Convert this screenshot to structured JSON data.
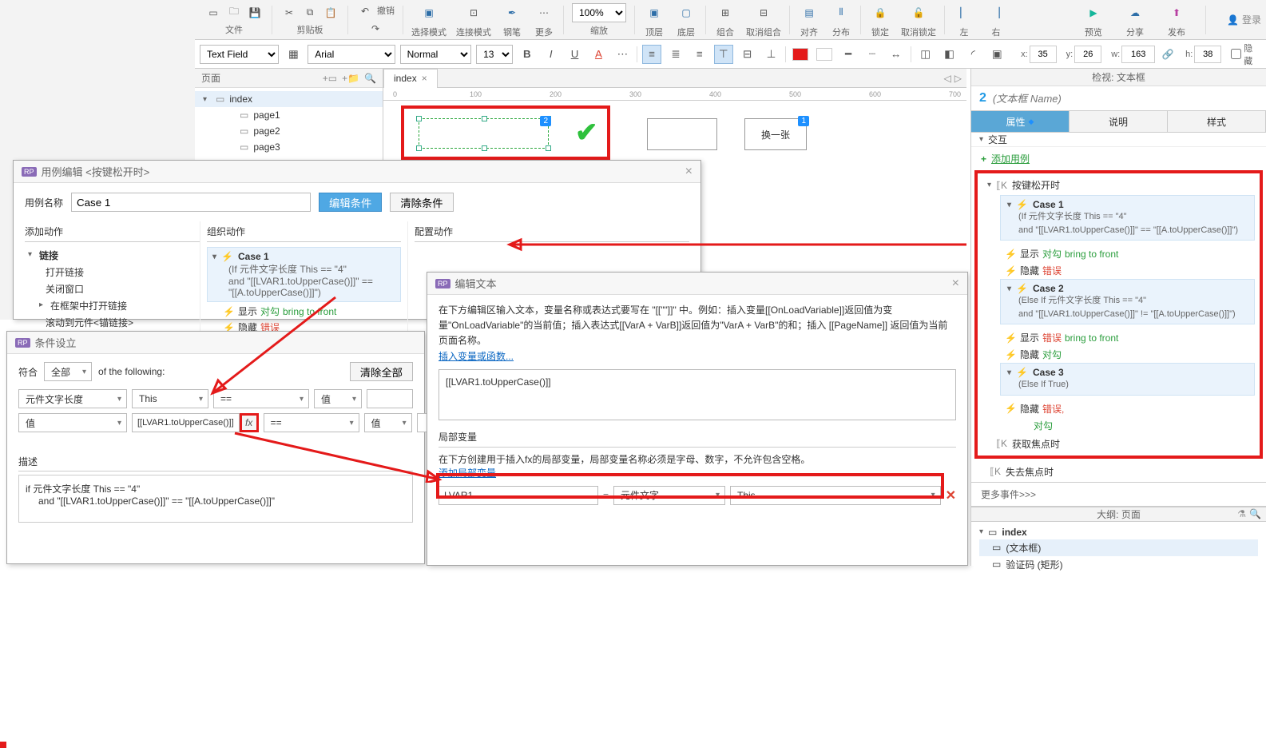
{
  "toolbar": {
    "groups": {
      "file": "文件",
      "clipboard": "剪贴板",
      "undo_label": "撤销",
      "selection_mode": "选择模式",
      "connect_mode": "连接模式",
      "pen": "钢笔",
      "more": "更多",
      "zoom": "缩放",
      "top_layer": "顶层",
      "bottom_layer": "底层",
      "group": "组合",
      "ungroup": "取消组合",
      "align": "对齐",
      "distribute": "分布",
      "lock": "锁定",
      "unlock": "取消锁定",
      "left": "左",
      "right": "右"
    },
    "zoom_value": "100%",
    "right": {
      "preview": "预览",
      "share": "分享",
      "publish": "发布"
    },
    "login": "登录"
  },
  "format": {
    "widget_type": "Text Field",
    "font": "Arial",
    "weight": "Normal",
    "size": "13",
    "coords": {
      "x_label": "x:",
      "x": "35",
      "y_label": "y:",
      "y": "26",
      "w_label": "w:",
      "w": "163",
      "h_label": "h:",
      "h": "38"
    },
    "hidden_label": "隐藏"
  },
  "pages": {
    "title": "页面",
    "root": "index",
    "children": [
      "page1",
      "page2",
      "page3"
    ]
  },
  "tabs": {
    "active": "index"
  },
  "canvas": {
    "ruler": [
      "0",
      "100",
      "200",
      "300",
      "400",
      "500",
      "600",
      "700"
    ],
    "badge1": "1",
    "badge2": "2",
    "button_label": "换一张"
  },
  "dlg1": {
    "title": "用例编辑 <按键松开时>",
    "name_label": "用例名称",
    "name_value": "Case 1",
    "btn_edit": "编辑条件",
    "btn_clear": "清除条件",
    "col_add": "添加动作",
    "col_org": "组织动作",
    "col_cfg": "配置动作",
    "tree": {
      "root": "链接",
      "items": [
        "打开链接",
        "关闭窗口",
        "在框架中打开链接",
        "滚动到元件<锚链接>"
      ]
    },
    "case": {
      "title": "Case 1",
      "cond1": "(If 元件文字长度 This == \"4\"",
      "cond2": "and \"[[LVAR1.toUpperCase()]]\" ==",
      "cond3": "\"[[A.toUpperCase()]]\")",
      "act1a": "显示",
      "act1b": "对勾",
      "act1c": "bring to front",
      "act2a": "隐藏",
      "act2b": "错误"
    }
  },
  "dlg2": {
    "title": "条件设立",
    "match_label": "符合",
    "match_value": "全部",
    "of_following": "of the following:",
    "btn_clear": "清除全部",
    "row1": {
      "c1": "元件文字长度",
      "c2": "This",
      "c3": "==",
      "c4": "值",
      "c5": ""
    },
    "row2": {
      "c1": "值",
      "c2_val": "[[LVAR1.toUpperCase()]]",
      "c2_fx": "fx",
      "c3": "==",
      "c4": "值",
      "c5": ""
    },
    "desc_label": "描述",
    "desc_line1": "if 元件文字长度 This == \"4\"",
    "desc_line2": "and \"[[LVAR1.toUpperCase()]]\" == \"[[A.toUpperCase()]]\""
  },
  "dlg3": {
    "title": "编辑文本",
    "info1": "在下方编辑区输入文本，变量名称或表达式要写在 \"[[\"\"]]\" 中。例如：插入变量[[OnLoadVariable]]返回值为变量\"OnLoadVariable\"的当前值；插入表达式[[VarA + VarB]]返回值为\"VarA + VarB\"的和；插入 [[PageName]] 返回值为当前页面名称。",
    "link_insert_var": "插入变量或函数...",
    "expr": "[[LVAR1.toUpperCase()]]",
    "local_label": "局部变量",
    "local_info": "在下方创建用于插入fx的局部变量，局部变量名称必须是字母、数字，不允许包含空格。",
    "link_add_local": "添加局部变量",
    "row": {
      "name": "LVAR1",
      "eq": "=",
      "source": "元件文字",
      "target": "This"
    }
  },
  "inspector": {
    "header": "检视: 文本框",
    "badge": "2",
    "name_placeholder": "(文本框 Name)",
    "tabs": {
      "props": "属性",
      "notes": "说明",
      "style": "样式"
    },
    "section_interact": "交互",
    "add_case": "添加用例",
    "event_keyup": "按键松开时",
    "case1": {
      "title": "Case 1",
      "cond": "(If 元件文字长度 This == \"4\"\nand \"[[LVAR1.toUpperCase()]]\" == \"[[A.toUpperCase()]]\")",
      "act1": {
        "a": "显示",
        "b": "对勾",
        "c": "bring to front"
      },
      "act2": {
        "a": "隐藏",
        "b": "错误"
      }
    },
    "case2": {
      "title": "Case 2",
      "cond": "(Else If 元件文字长度 This == \"4\"\nand \"[[LVAR1.toUpperCase()]]\" != \"[[A.toUpperCase()]]\")",
      "act1": {
        "a": "显示",
        "b": "错误",
        "c": "bring to front"
      },
      "act2": {
        "a": "隐藏",
        "b": "对勾"
      }
    },
    "case3": {
      "title": "Case 3",
      "cond": "(Else If True)",
      "act1": {
        "a": "隐藏",
        "b": "错误,"
      },
      "act2": {
        "b": "对勾"
      }
    },
    "event_focus": "获取焦点时",
    "event_blur": "失去焦点时",
    "more_events": "更多事件>>>",
    "outline_header": "大纲: 页面",
    "outline_root": "index",
    "outline_item": "(文本框)",
    "outline_item2": "验证码 (矩形)"
  }
}
